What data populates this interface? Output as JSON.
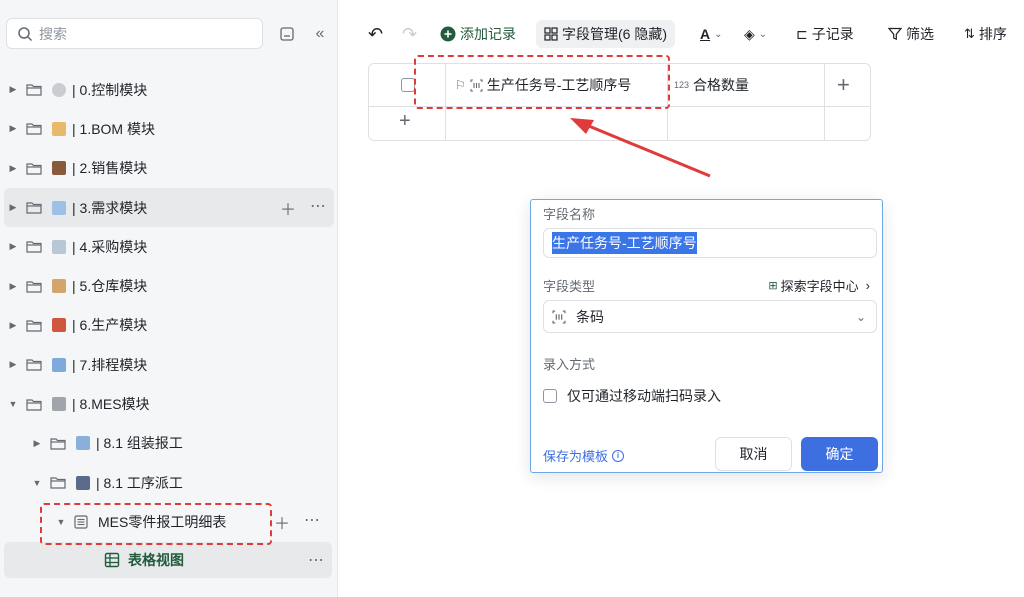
{
  "sidebar": {
    "search_placeholder": "搜索",
    "items": [
      {
        "label": "| 0.控制模块"
      },
      {
        "label": "| 1.BOM 模块"
      },
      {
        "label": "| 2.销售模块"
      },
      {
        "label": "| 3.需求模块"
      },
      {
        "label": "| 4.采购模块"
      },
      {
        "label": "| 5.仓库模块"
      },
      {
        "label": "| 6.生产模块"
      },
      {
        "label": "| 7.排程模块"
      },
      {
        "label": "| 8.MES模块"
      },
      {
        "label": "| 8.1 组装报工"
      },
      {
        "label": "| 8.1 工序派工"
      },
      {
        "label": "MES零件报工明细表"
      },
      {
        "label": "表格视图"
      }
    ]
  },
  "toolbar": {
    "add_record": "添加记录",
    "field_mgmt": "字段管理(6 隐藏)",
    "child_record": "子记录",
    "filter": "筛选",
    "sort": "排序"
  },
  "table": {
    "col1": "生产任务号-工艺顺序号",
    "col2_prefix": "123",
    "col2": "合格数量"
  },
  "dialog": {
    "field_name_label": "字段名称",
    "field_name_value": "生产任务号-工艺顺序号",
    "field_type_label": "字段类型",
    "explore_link": "探索字段中心",
    "field_type_value": "条码",
    "entry_label": "录入方式",
    "checkbox_label": "仅可通过移动端扫码录入",
    "save_template": "保存为模板",
    "cancel": "取消",
    "confirm": "确定"
  },
  "colors": {
    "accent": "#3d6fe0",
    "annotation": "#e03a3a",
    "active_view": "#245b3e"
  }
}
